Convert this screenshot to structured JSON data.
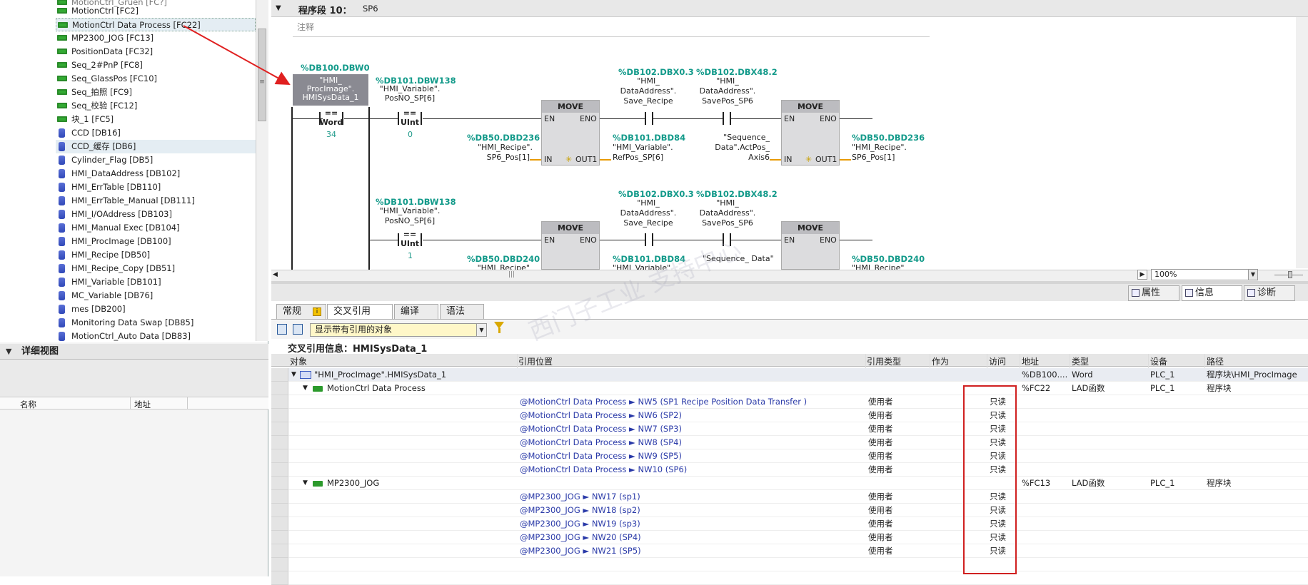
{
  "tree": {
    "cut_top": "MotionCtrl_Gruen [FC?]",
    "items": [
      {
        "label": "MotionCtrl [FC2]",
        "kind": "fc"
      },
      {
        "label": "MotionCtrl Data Process [FC22]",
        "kind": "fc",
        "selected": true
      },
      {
        "label": "MP2300_JOG [FC13]",
        "kind": "fc"
      },
      {
        "label": "PositionData [FC32]",
        "kind": "fc"
      },
      {
        "label": "Seq_2#PnP [FC8]",
        "kind": "fc"
      },
      {
        "label": "Seq_GlassPos [FC10]",
        "kind": "fc"
      },
      {
        "label": "Seq_拍照 [FC9]",
        "kind": "fc"
      },
      {
        "label": "Seq_校验 [FC12]",
        "kind": "fc"
      },
      {
        "label": "块_1 [FC5]",
        "kind": "fc"
      },
      {
        "label": "CCD [DB16]",
        "kind": "db"
      },
      {
        "label": "CCD_缓存 [DB6]",
        "kind": "db",
        "highlight": true
      },
      {
        "label": "Cylinder_Flag [DB5]",
        "kind": "db"
      },
      {
        "label": "HMI_DataAddress [DB102]",
        "kind": "db"
      },
      {
        "label": "HMI_ErrTable [DB110]",
        "kind": "db"
      },
      {
        "label": "HMI_ErrTable_Manual [DB111]",
        "kind": "db"
      },
      {
        "label": "HMI_I/OAddress [DB103]",
        "kind": "db"
      },
      {
        "label": "HMI_Manual Exec [DB104]",
        "kind": "db"
      },
      {
        "label": "HMI_ProcImage [DB100]",
        "kind": "db"
      },
      {
        "label": "HMI_Recipe [DB50]",
        "kind": "db"
      },
      {
        "label": "HMI_Recipe_Copy [DB51]",
        "kind": "db"
      },
      {
        "label": "HMI_Variable [DB101]",
        "kind": "db"
      },
      {
        "label": "MC_Variable [DB76]",
        "kind": "db"
      },
      {
        "label": "mes [DB200]",
        "kind": "db"
      },
      {
        "label": "Monitoring Data Swap [DB85]",
        "kind": "db"
      },
      {
        "label": "MotionCtrl_Auto Data [DB83]",
        "kind": "db"
      }
    ]
  },
  "detail_view": {
    "title": "详细视图",
    "col_name": "名称",
    "col_addr": "地址"
  },
  "network": {
    "title": "程序段 10：",
    "name": "SP6",
    "comment": "注释",
    "row1": {
      "cmp_addr": "%DB100.DBW0",
      "cmp_op": [
        "\"HMI_",
        "ProcImage\".",
        "HMISysData_1"
      ],
      "cmp_sym": "==",
      "cmp_type": "Word",
      "cmp_val": "34",
      "c2_addr": "%DB101.DBW138",
      "c2_op": [
        "\"HMI_Variable\".",
        "PosNO_SP[6]"
      ],
      "c2_sym": "==",
      "c2_type": "UInt",
      "c2_val": "0",
      "move_label": "MOVE",
      "en": "EN",
      "eno": "ENO",
      "in": "IN",
      "out": "OUT1",
      "m1_in_addr": "%DB50.DBD236",
      "m1_in_op": [
        "\"HMI_Recipe\".",
        "SP6_Pos[1]"
      ],
      "m1_out_addr": "%DB101.DBD84",
      "m1_out_op": [
        "\"HMI_Variable\".",
        "RefPos_SP[6]"
      ],
      "no1_addr": "%DB102.DBX0.3",
      "no1_op": [
        "\"HMI_",
        "DataAddress\".",
        "Save_Recipe"
      ],
      "no2_addr": "%DB102.DBX48.2",
      "no2_op": [
        "\"HMI_",
        "DataAddress\".",
        "SavePos_SP6"
      ],
      "m2_in_op": [
        "\"Sequence_",
        "Data\".ActPos_",
        "Axis6"
      ],
      "m2_out_addr": "%DB50.DBD236",
      "m2_out_op": [
        "\"HMI_Recipe\".",
        "SP6_Pos[1]"
      ]
    },
    "row2": {
      "c2_addr": "%DB101.DBW138",
      "c2_op": [
        "\"HMI_Variable\".",
        "PosNO_SP[6]"
      ],
      "c2_sym": "==",
      "c2_type": "UInt",
      "c2_val": "1",
      "no1_addr": "%DB102.DBX0.3",
      "no1_op": [
        "\"HMI_",
        "DataAddress\".",
        "Save_Recipe"
      ],
      "no2_addr": "%DB102.DBX48.2",
      "no2_op": [
        "\"HMI_",
        "DataAddress\".",
        "SavePos_SP6"
      ],
      "m1_in_addr": "%DB50.DBD240",
      "m1_in_cut": "\"HMI_Recipe\"",
      "m1_out_addr": "%DB101.DBD84",
      "m1_out_cut": "\"HMI_Variable\"",
      "m2_in_cut": "\"Sequence_  Data\".ActPos_",
      "m2_out_addr": "%DB50.DBD240",
      "m2_out_cut": "\"HMI_Recipe\""
    },
    "zoom": "100%"
  },
  "inspector": {
    "tabs": [
      "属性",
      "信息",
      "诊断"
    ],
    "active": "信息"
  },
  "subtabs": {
    "items": [
      "常规",
      "交叉引用",
      "编译",
      "语法"
    ],
    "active": "交叉引用"
  },
  "toolbar": {
    "filter_value": "显示带有引用的对象"
  },
  "xref": {
    "title": "交叉引用信息：HMISysData_1",
    "headers": [
      "对象",
      "引用位置",
      "引用类型",
      "作为",
      "访问",
      "地址",
      "类型",
      "设备",
      "路径"
    ],
    "root": {
      "object": "\"HMI_ProcImage\".HMISysData_1",
      "address": "%DB100....",
      "type": "Word",
      "device": "PLC_1",
      "path": "程序块\\HMI_ProcImage"
    },
    "groups": [
      {
        "object": "MotionCtrl Data Process",
        "address": "%FC22",
        "type": "LAD函数",
        "device": "PLC_1",
        "path": "程序块",
        "refs": [
          {
            "loc": "@MotionCtrl Data Process ► NW5 (SP1  Recipe Position Data Transfer )",
            "reftype": "使用者",
            "access": "只读"
          },
          {
            "loc": "@MotionCtrl Data Process ► NW6 (SP2)",
            "reftype": "使用者",
            "access": "只读"
          },
          {
            "loc": "@MotionCtrl Data Process ► NW7 (SP3)",
            "reftype": "使用者",
            "access": "只读"
          },
          {
            "loc": "@MotionCtrl Data Process ► NW8 (SP4)",
            "reftype": "使用者",
            "access": "只读"
          },
          {
            "loc": "@MotionCtrl Data Process ► NW9 (SP5)",
            "reftype": "使用者",
            "access": "只读"
          },
          {
            "loc": "@MotionCtrl Data Process ► NW10 (SP6)",
            "reftype": "使用者",
            "access": "只读"
          }
        ]
      },
      {
        "object": "MP2300_JOG",
        "address": "%FC13",
        "type": "LAD函数",
        "device": "PLC_1",
        "path": "程序块",
        "refs": [
          {
            "loc": "@MP2300_JOG ► NW17 (sp1)",
            "reftype": "使用者",
            "access": "只读"
          },
          {
            "loc": "@MP2300_JOG ► NW18 (sp2)",
            "reftype": "使用者",
            "access": "只读"
          },
          {
            "loc": "@MP2300_JOG ► NW19 (sp3)",
            "reftype": "使用者",
            "access": "只读"
          },
          {
            "loc": "@MP2300_JOG ► NW20 (SP4)",
            "reftype": "使用者",
            "access": "只读"
          },
          {
            "loc": "@MP2300_JOG ► NW21 (SP5)",
            "reftype": "使用者",
            "access": "只读"
          }
        ]
      }
    ]
  }
}
